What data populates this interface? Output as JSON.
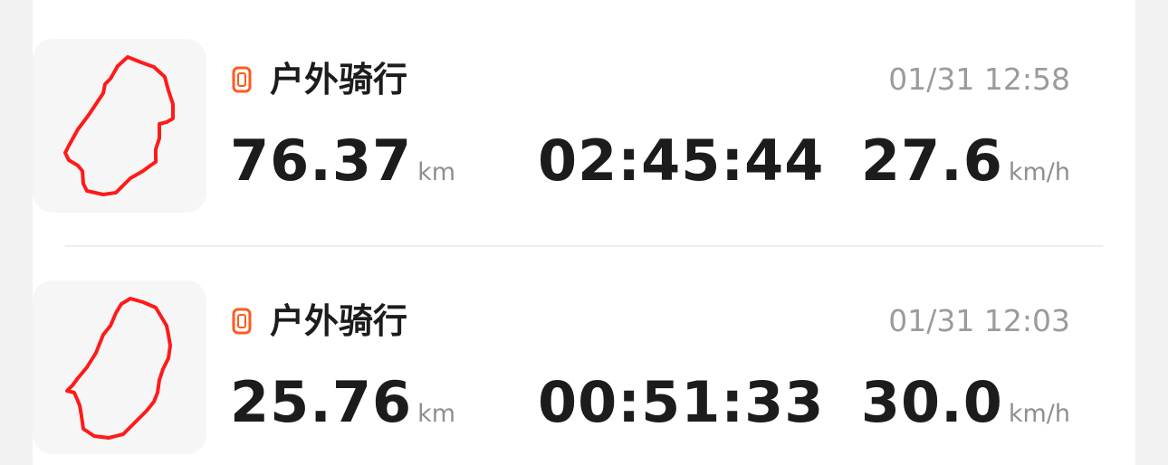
{
  "records": [
    {
      "activity_icon": "watch-device-icon",
      "title": "户外骑行",
      "datetime": "01/31 12:58",
      "distance": {
        "value": "76.37",
        "unit": "km"
      },
      "duration": "02:45:44",
      "avg_speed": {
        "value": "27.6",
        "unit": "km/h"
      },
      "route_color": "#ff1a1a"
    },
    {
      "activity_icon": "watch-device-icon",
      "title": "户外骑行",
      "datetime": "01/31 12:03",
      "distance": {
        "value": "25.76",
        "unit": "km"
      },
      "duration": "00:51:33",
      "avg_speed": {
        "value": "30.0",
        "unit": "km/h"
      },
      "route_color": "#ff1a1a"
    }
  ],
  "colors": {
    "accent": "#ff5a1f",
    "text_primary": "#1c1c1c",
    "text_secondary": "#9b9b9b"
  }
}
